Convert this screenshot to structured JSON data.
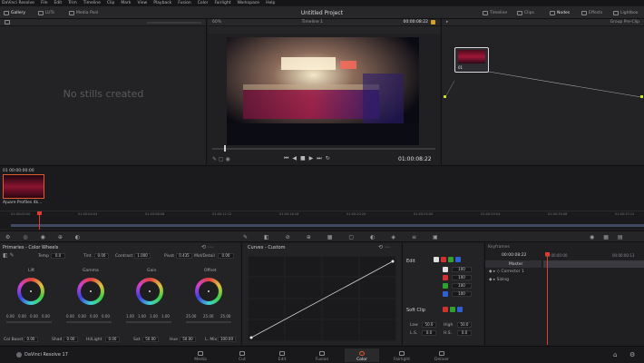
{
  "menubar": {
    "app": "DaVinci Resolve",
    "items": [
      "File",
      "Edit",
      "Trim",
      "Timeline",
      "Clip",
      "Mark",
      "View",
      "Playback",
      "Fusion",
      "Color",
      "Fairlight",
      "Workspace",
      "Help"
    ]
  },
  "topbar": {
    "gallery": "Gallery",
    "luts": "LUTs",
    "media_pool": "Media Pool",
    "project_title": "Untitled Project",
    "timeline": "Timeline",
    "clips": "Clips",
    "nodes": "Nodes",
    "effects": "Effects",
    "lightbox": "Lightbox"
  },
  "viewer": {
    "zoom": "60%",
    "timeline_name": "Timeline 1",
    "timecode_top": "00:00:08:22",
    "timecode": "01:00:08:22"
  },
  "gallery": {
    "empty_text": "No stills created"
  },
  "nodes_panel": {
    "mode": "Group Pre-Clip",
    "node_label": "01"
  },
  "clip": {
    "index": "01",
    "timecode": "00:00:00:00",
    "name": "Ajuare Profiles 4k..."
  },
  "ruler": {
    "ticks": [
      "01:00:00:00",
      "01:00:04:04",
      "01:00:08:08",
      "01:00:12:12",
      "01:00:16:16",
      "01:00:20:20",
      "01:00:25:00",
      "01:00:29:04",
      "01:00:33:08",
      "01:00:37:12"
    ]
  },
  "primaries": {
    "title": "Primaries - Color Wheels",
    "temp_label": "Temp",
    "temp": "0.0",
    "tint_label": "Tint",
    "tint": "0.00",
    "contrast_label": "Contrast",
    "contrast": "1.000",
    "pivot_label": "Pivot",
    "pivot": "0.435",
    "middetail_label": "Mid/Detail",
    "middetail": "0.00",
    "wheels": [
      {
        "name": "Lift",
        "v": [
          "0.00",
          "0.00",
          "0.00",
          "0.00"
        ]
      },
      {
        "name": "Gamma",
        "v": [
          "0.00",
          "0.00",
          "0.00",
          "0.00"
        ]
      },
      {
        "name": "Gain",
        "v": [
          "1.00",
          "1.00",
          "1.00",
          "1.00"
        ]
      },
      {
        "name": "Offset",
        "v": [
          "25.00",
          "25.00",
          "25.00",
          ""
        ]
      }
    ],
    "col_boost_label": "Col Boost",
    "col_boost": "0.00",
    "shad_label": "Shad",
    "shad": "0.00",
    "hilight_label": "Hi/Light",
    "hilight": "0.00",
    "sat_label": "Sat",
    "sat": "50.00",
    "hue_label": "Hue",
    "hue": "50.00",
    "lmix_label": "L. Mix",
    "lmix": "100.00"
  },
  "curves": {
    "title": "Curves - Custom"
  },
  "edit": {
    "title": "Edit",
    "values": [
      "100",
      "100",
      "100",
      "100"
    ],
    "soft_clip": "Soft Clip",
    "low_label": "Low",
    "low": "50.0",
    "high_label": "High",
    "high": "50.0",
    "ls_label": "L.S.",
    "ls": "0.0",
    "hs_label": "H.S.",
    "hs": "0.0"
  },
  "keyframes": {
    "title": "Keyframes",
    "timecode": "00:00:08:22",
    "start": "00:00:00:00",
    "end": "00:00:00:13",
    "master": "Master",
    "corrector": "Corrector 1",
    "sizing": "Sizing"
  },
  "pages": [
    "Media",
    "Cut",
    "Edit",
    "Fusion",
    "Color",
    "Fairlight",
    "Deliver"
  ],
  "brand": "DaVinci Resolve 17",
  "colors": {
    "accent": "#e05a2a",
    "playhead": "#e23b2e",
    "curve": "#d0d0d0"
  }
}
